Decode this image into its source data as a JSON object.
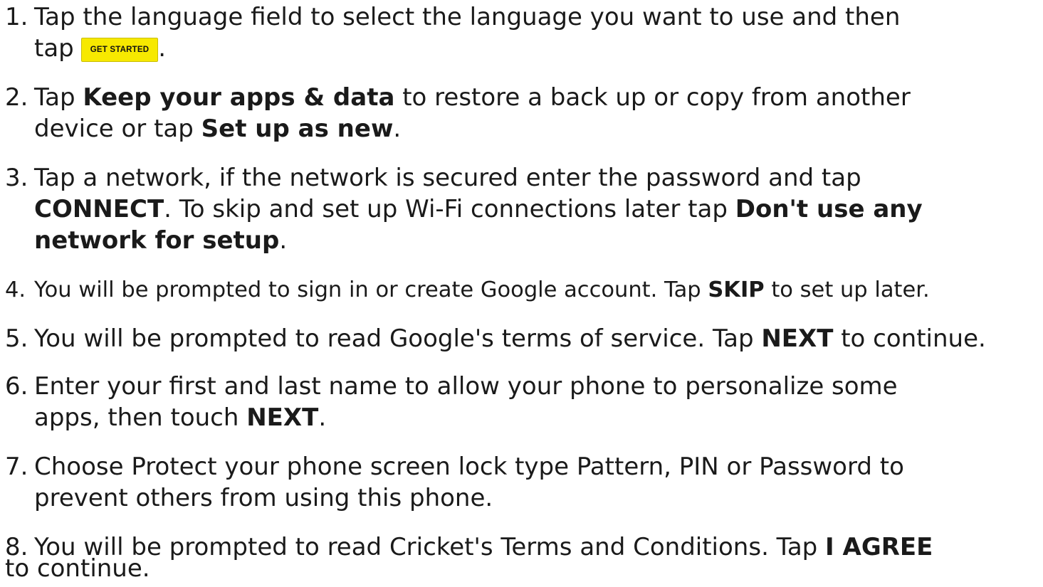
{
  "steps": [
    {
      "number": "1.",
      "line1": "Tap the language field to select the language you want to use and then",
      "line2_pre": "tap",
      "button_label": "GET STARTED",
      "line2_post": "."
    },
    {
      "number": "2.",
      "pre": "Tap ",
      "bold1": "Keep your apps & data",
      "mid": " to restore a back up or copy from another",
      "line2_pre": "device or tap ",
      "bold2": "Set up as new",
      "post": "."
    },
    {
      "number": "3.",
      "line1": "Tap a network, if the network is secured enter the password and tap",
      "bold1": "CONNECT",
      "mid": ". To skip and set up Wi-Fi connections later tap ",
      "bold2a": "Don't use any",
      "bold2b": "network for setup",
      "post": "."
    },
    {
      "number": "4.",
      "pre": "You will be prompted to sign in or create Google account. Tap ",
      "bold": "SKIP",
      "post": " to set up later."
    },
    {
      "number": "5.",
      "pre": "You will be prompted to read Google's terms of service. Tap ",
      "bold": "NEXT",
      "post": " to continue."
    },
    {
      "number": "6.",
      "line1": "Enter your first and last name to allow your phone to personalize some",
      "line2_pre": "apps, then touch ",
      "bold": "NEXT",
      "post": "."
    },
    {
      "number": "7.",
      "line1": "Choose Protect your phone screen lock type Pattern, PIN or Password to",
      "line2": "prevent others from using this phone."
    },
    {
      "number": "8.",
      "pre": "You will be prompted to read Cricket's Terms and Conditions. Tap ",
      "bold": "I AGREE",
      "line2": "to continue."
    }
  ]
}
